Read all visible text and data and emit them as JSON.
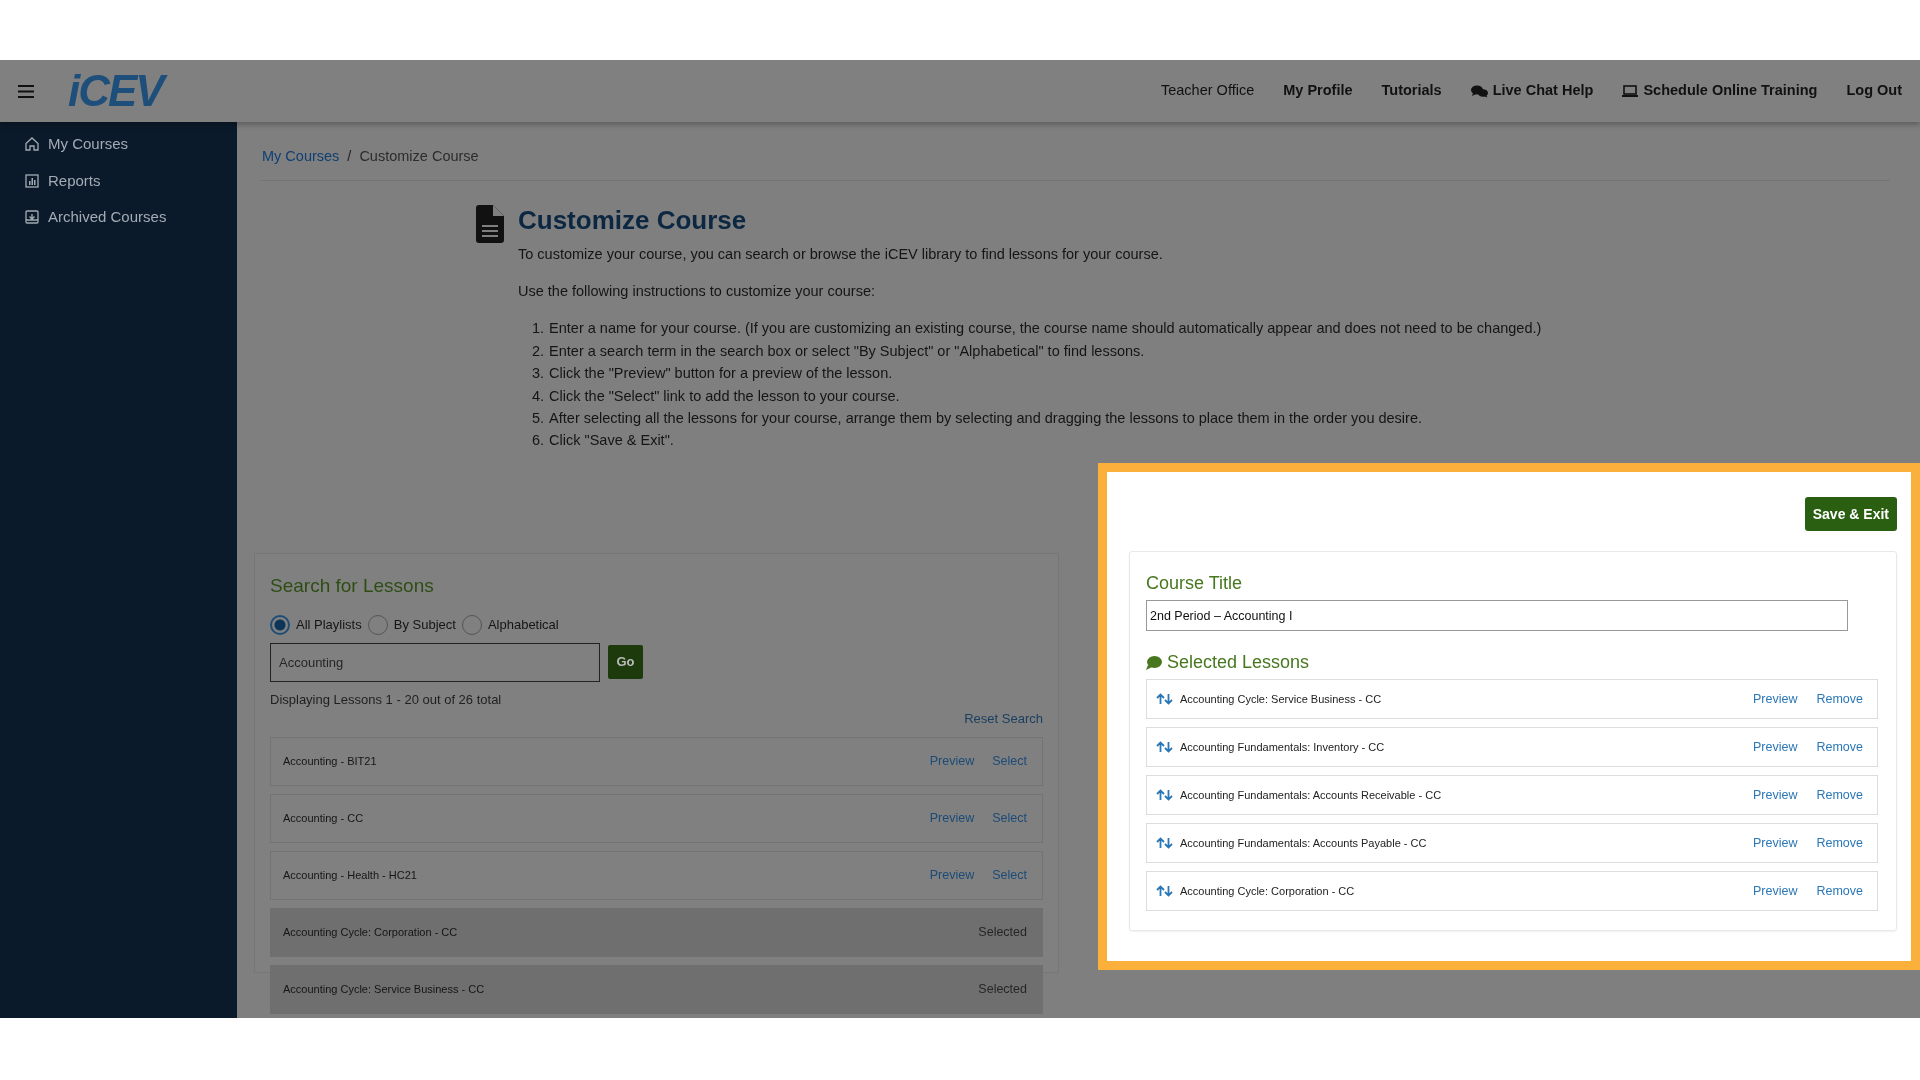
{
  "header": {
    "logo": "iCEV",
    "links": [
      {
        "label": "Teacher Office",
        "kind": "text"
      },
      {
        "label": "My Profile",
        "kind": "link"
      },
      {
        "label": "Tutorials",
        "kind": "link"
      },
      {
        "label": "Live Chat Help",
        "kind": "link"
      },
      {
        "label": "Schedule Online Training",
        "kind": "link"
      },
      {
        "label": "Log Out",
        "kind": "link"
      }
    ]
  },
  "sidebar": {
    "items": [
      {
        "label": "My Courses"
      },
      {
        "label": "Reports"
      },
      {
        "label": "Archived Courses"
      }
    ]
  },
  "breadcrumb": [
    {
      "label": "My Courses",
      "current": false
    },
    {
      "separator": "/",
      "label": "Customize Course",
      "current": true
    }
  ],
  "intro": {
    "title": "Customize Course",
    "description": "To customize your course, you can search or browse the iCEV library to find lessons for your course.",
    "lead": "Use the following instructions to customize your course:",
    "steps": [
      {
        "number": "1.",
        "text": "Enter a name for your course. (If you are customizing an existing course, the course name should automatically appear and does not need to be changed.)"
      },
      {
        "number": "2.",
        "text": "Enter a search term in the search box or select \"By Subject\" or \"Alphabetical\" to find lessons."
      },
      {
        "number": "3.",
        "text": "Click the \"Preview\" button for a preview of the lesson."
      },
      {
        "number": "4.",
        "text": "Click the \"Select\" link to add the lesson to your course."
      },
      {
        "number": "5.",
        "text": "After selecting all the lessons for your course, arrange them by selecting and dragging the lessons to place them in the order you desire."
      },
      {
        "number": "6.",
        "text": "Click \"Save & Exit\"."
      }
    ]
  },
  "search": {
    "title": "Search for Lessons",
    "options": [
      {
        "label": "All Playlists",
        "selected": true
      },
      {
        "label": "By Subject",
        "selected": false
      },
      {
        "label": "Alphabetical",
        "selected": false
      }
    ],
    "query": "Accounting",
    "go": "Go",
    "count": "Displaying Lessons 1 - 20 out of 26 total",
    "reset": "Reset Search",
    "results": [
      {
        "title": "Accounting - BIT21",
        "selected": false,
        "preview": "Preview",
        "select": "Select"
      },
      {
        "title": "Accounting - CC",
        "selected": false,
        "preview": "Preview",
        "select": "Select"
      },
      {
        "title": "Accounting - Health - HC21",
        "selected": false,
        "preview": "Preview",
        "select": "Select"
      },
      {
        "title": "Accounting Cycle: Corporation - CC",
        "selected": true,
        "status": "Selected"
      },
      {
        "title": "Accounting Cycle: Service Business - CC",
        "selected": true,
        "status": "Selected"
      }
    ]
  },
  "course_panel": {
    "save": "Save & Exit",
    "title_label": "Course Title",
    "title_value": "2nd Period – Accounting I",
    "lessons_title": "Selected Lessons",
    "lessons": [
      {
        "title": "Accounting Cycle: Service Business - CC",
        "preview": "Preview",
        "remove": "Remove"
      },
      {
        "title": "Accounting Fundamentals: Inventory - CC",
        "preview": "Preview",
        "remove": "Remove"
      },
      {
        "title": "Accounting Fundamentals: Accounts Receivable - CC",
        "preview": "Preview",
        "remove": "Remove"
      },
      {
        "title": "Accounting Fundamentals: Accounts Payable - CC",
        "preview": "Preview",
        "remove": "Remove"
      },
      {
        "title": "Accounting Cycle: Corporation - CC",
        "preview": "Preview",
        "remove": "Remove"
      }
    ]
  }
}
